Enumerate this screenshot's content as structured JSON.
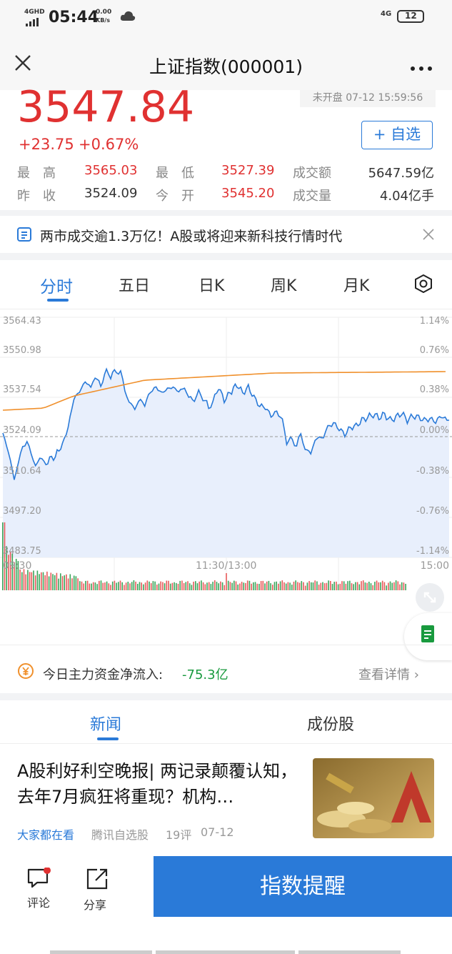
{
  "status_bar": {
    "network": "4GHD",
    "time": "05:44",
    "speed": "0.00",
    "speed_unit": "KB/s",
    "net_right": "4G",
    "battery": "12"
  },
  "header": {
    "title": "上证指数(000001)"
  },
  "quote": {
    "price": "3547.84",
    "change": "+23.75",
    "change_pct": "+0.67%",
    "market_status": "未开盘 07-12 15:59:56",
    "watch_button": "+ 自选",
    "stats": [
      {
        "label": "最　高",
        "value": "3565.03"
      },
      {
        "label": "最　低",
        "value": "3527.39"
      },
      {
        "label": "成交额",
        "value": "5647.59亿"
      },
      {
        "label": "昨　收",
        "value": "3524.09"
      },
      {
        "label": "今　开",
        "value": "3545.20"
      },
      {
        "label": "成交量",
        "value": "4.04亿手"
      }
    ]
  },
  "notice": {
    "text": "两市成交逾1.3万亿！A股或将迎来新科技行情时代"
  },
  "chart_tabs": [
    "分时",
    "五日",
    "日K",
    "周K",
    "月K"
  ],
  "chart_data": {
    "type": "line",
    "series": [],
    "y_ticks_left": [
      "3564.43",
      "3550.98",
      "3537.54",
      "3524.09",
      "3510.64",
      "3497.20",
      "3483.75"
    ],
    "y_ticks_right": [
      "1.14%",
      "0.76%",
      "0.38%",
      "0.00%",
      "-0.38%",
      "-0.76%",
      "-1.14%"
    ],
    "x_ticks": [
      "09:30",
      "11:30/13:00",
      "15:00"
    ],
    "ylim": [
      3483.75,
      3564.43
    ],
    "colors": {
      "price": "#2a7ad8",
      "avg": "#f0902c",
      "fill": "#e8effc",
      "up": "#e03131",
      "down": "#199a3e"
    }
  },
  "fund_flow": {
    "label": "今日主力资金净流入:",
    "value": "-75.3亿",
    "detail_link": "查看详情 ›"
  },
  "news_tabs": [
    "新闻",
    "成份股"
  ],
  "news": {
    "title": "A股利好利空晚报| 两记录颠覆认知，去年7月疯狂将重现？机构…",
    "tag": "大家都在看",
    "source": "腾讯自选股",
    "comments": "19评",
    "date": "07-12"
  },
  "bottom_bar": {
    "comment": "评论",
    "share": "分享",
    "alert_button": "指数提醒"
  }
}
